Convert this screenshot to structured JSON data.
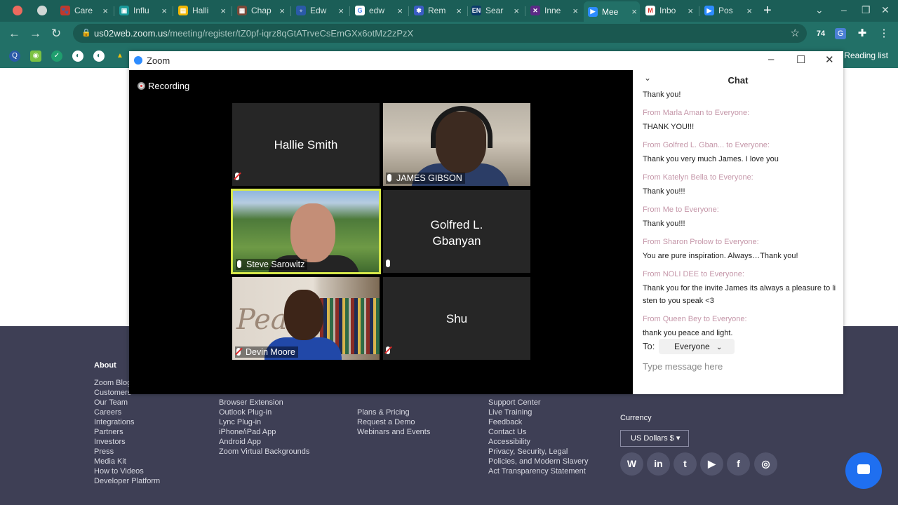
{
  "browser": {
    "tabs": [
      {
        "label": "Care",
        "fav_color": "#c0392b",
        "fav_glyph": "🐾"
      },
      {
        "label": "Influ",
        "fav_color": "#1a9a9a",
        "fav_glyph": "▣"
      },
      {
        "label": "Halli",
        "fav_color": "#f2b705",
        "fav_glyph": "▤"
      },
      {
        "label": "Chap",
        "fav_color": "#7a4a3a",
        "fav_glyph": "▦"
      },
      {
        "label": "Edw",
        "fav_color": "#2a5aa8",
        "fav_glyph": "♆"
      },
      {
        "label": "edw",
        "fav_color": "#ffffff",
        "fav_glyph": "G"
      },
      {
        "label": "Rem",
        "fav_color": "#3b5cc4",
        "fav_glyph": "✱"
      },
      {
        "label": "Sear",
        "fav_color": "#0c3b6b",
        "fav_glyph": "EN"
      },
      {
        "label": "Inne",
        "fav_color": "#5b2a86",
        "fav_glyph": "✕"
      },
      {
        "label": "Mee",
        "fav_color": "#2d8cff",
        "fav_glyph": "▶"
      },
      {
        "label": "Inbo",
        "fav_color": "#d93025",
        "fav_glyph": "M"
      },
      {
        "label": "Pos",
        "fav_color": "#2d8cff",
        "fav_glyph": "▶"
      }
    ],
    "url_host": "us02web.zoom.us",
    "url_path": "/meeting/register/tZ0pf-iqrz8qGtATrveCsEmGXx6otMz2zPzX",
    "ext_badge": "74",
    "reading_list": "Reading list"
  },
  "zoom": {
    "title": "Zoom",
    "recording_label": "Recording",
    "participants": {
      "hallie": "Hallie Smith",
      "james": "JAMES GIBSON",
      "steve": "Steve Sarowitz",
      "golfred": "Golfred L. Gbanyan",
      "devin": "Devin Moore",
      "shu": "Shu"
    },
    "chat": {
      "title": "Chat",
      "first_text": "Thank you!",
      "messages": [
        {
          "from": "From Marla Aman to Everyone:",
          "text": "THANK YOU!!!"
        },
        {
          "from": "From Golfred L. Gban... to Everyone:",
          "text": "Thank you very much James. I love you"
        },
        {
          "from": "From Katelyn Bella to Everyone:",
          "text": "Thank you!!!"
        },
        {
          "from": "From Me to Everyone:",
          "text": "Thank you!!!"
        },
        {
          "from": "From Sharon Prolow to Everyone:",
          "text": "You are pure inspiration. Always…Thank you!"
        },
        {
          "from": "From NOLI DEE to Everyone:",
          "text": "Thank you for the invite James its always a pleasure to listen to you speak <3"
        },
        {
          "from": "From Queen Bey to Everyone:",
          "text": "thank you peace and light."
        }
      ],
      "to_label": "To:",
      "to_value": "Everyone",
      "input_placeholder": "Type message here"
    }
  },
  "footer": {
    "about": {
      "title": "About",
      "links": [
        "Zoom Blog",
        "Customers",
        "Our Team",
        "Careers",
        "Integrations",
        "Partners",
        "Investors",
        "Press",
        "Media Kit",
        "How to Videos",
        "Developer Platform"
      ]
    },
    "download": {
      "links": [
        "Browser Extension",
        "Outlook Plug-in",
        "Lync Plug-in",
        "iPhone/iPad App",
        "Android App",
        "Zoom Virtual Backgrounds"
      ]
    },
    "sales": {
      "links": [
        "Plans & Pricing",
        "Request a Demo",
        "Webinars and Events"
      ]
    },
    "support": {
      "links": [
        "Support Center",
        "Live Training",
        "Feedback",
        "Contact Us",
        "Accessibility",
        "Privacy, Security, Legal",
        "Policies, and Modern Slavery",
        "Act Transparency Statement"
      ]
    },
    "currency_title": "Currency",
    "currency_value": "US Dollars $"
  }
}
